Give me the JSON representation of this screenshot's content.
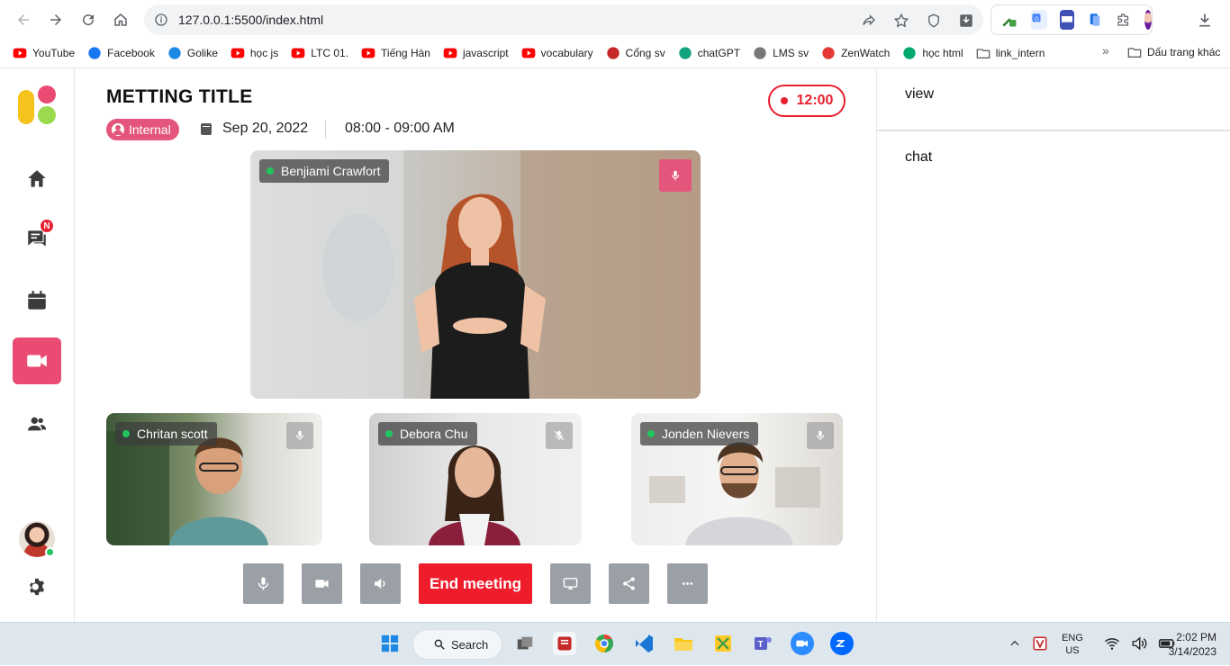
{
  "browser": {
    "url": "127.0.0.1:5500/index.html",
    "bookmarks": [
      {
        "label": "YouTube",
        "icon": "youtube-icon",
        "color": "#ff0000"
      },
      {
        "label": "Facebook",
        "icon": "facebook-icon",
        "color": "#1877f2"
      },
      {
        "label": "Golike",
        "icon": "golike-icon",
        "color": "#1e88e5"
      },
      {
        "label": "học js",
        "icon": "youtube-icon",
        "color": "#ff0000"
      },
      {
        "label": "LTC 01.",
        "icon": "youtube-icon",
        "color": "#ff0000"
      },
      {
        "label": "Tiếng Hàn",
        "icon": "youtube-icon",
        "color": "#ff0000"
      },
      {
        "label": "javascript",
        "icon": "youtube-icon",
        "color": "#ff0000"
      },
      {
        "label": "vocabulary",
        "icon": "youtube-icon",
        "color": "#ff0000"
      },
      {
        "label": "Cổng sv",
        "icon": "school-icon",
        "color": "#c62828"
      },
      {
        "label": "chatGPT",
        "icon": "openai-icon",
        "color": "#10a37f"
      },
      {
        "label": "LMS sv",
        "icon": "lms-icon",
        "color": "#777777"
      },
      {
        "label": "ZenWatch",
        "icon": "zenwatch-icon",
        "color": "#e53935"
      },
      {
        "label": "học html",
        "icon": "w3-icon",
        "color": "#04aa6d"
      },
      {
        "label": "link_intern",
        "icon": "folder-icon",
        "color": "#5f6368"
      }
    ],
    "other_bookmarks": "Dấu trang khác"
  },
  "sidebar": {
    "badge": "N",
    "items": [
      "home-icon",
      "chat-icon",
      "calendar-icon",
      "video-icon",
      "users-icon"
    ],
    "active_color": "#e94b73"
  },
  "meeting": {
    "title": "METTING TITLE",
    "tag": "Internal",
    "date": "Sep 20, 2022",
    "time": "08:00 - 09:00 AM",
    "timer": "12:00"
  },
  "participants": {
    "main": {
      "name": "Benjiami Crawfort",
      "mic": "on"
    },
    "tiles": [
      {
        "name": "Chritan scott",
        "mic": "on"
      },
      {
        "name": "Debora Chu",
        "mic": "muted"
      },
      {
        "name": "Jonden Nievers",
        "mic": "on"
      }
    ]
  },
  "controls": {
    "end_label": "End meeting",
    "buttons": [
      "mic-icon",
      "camera-icon",
      "volume-icon",
      "screen-share-icon",
      "share-icon",
      "more-icon"
    ],
    "end_color": "#ef1c2c"
  },
  "right_panel": {
    "view_label": "view",
    "chat_label": "chat"
  },
  "taskbar": {
    "search_label": "Search",
    "lang": "ENG",
    "region": "US",
    "time": "2:02 PM",
    "date": "3/14/2023"
  }
}
